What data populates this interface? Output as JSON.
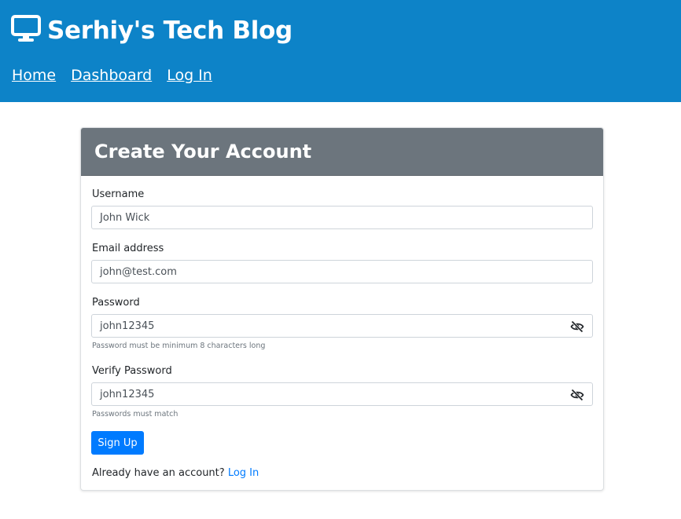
{
  "header": {
    "brand_icon": "monitor-icon",
    "title": "Serhiy's Tech Blog",
    "background_color": "#0d83c8",
    "nav": [
      {
        "label": "Home"
      },
      {
        "label": "Dashboard"
      },
      {
        "label": "Log In"
      }
    ]
  },
  "form": {
    "title": "Create Your Account",
    "header_color": "#6c757d",
    "username": {
      "label": "Username",
      "value": "John Wick"
    },
    "email": {
      "label": "Email address",
      "value": "john@test.com"
    },
    "password": {
      "label": "Password",
      "value": "john12345",
      "help": "Password must be minimum 8 characters long",
      "toggle_icon": "eye-slash-icon"
    },
    "verify_password": {
      "label": "Verify Password",
      "value": "john12345",
      "help": "Passwords must match",
      "toggle_icon": "eye-slash-icon"
    },
    "submit_label": "Sign Up",
    "submit_color": "#007bff",
    "login_prompt": "Already have an account?",
    "login_link": "Log In"
  }
}
